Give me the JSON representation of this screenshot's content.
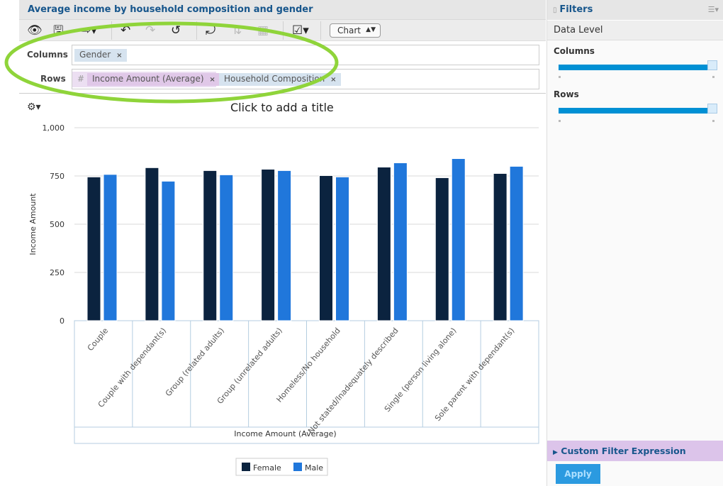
{
  "header": {
    "title": "Average income by household composition and gender"
  },
  "toolbar": {
    "chart_type": "Chart",
    "icons": [
      "eye-icon",
      "save-icon",
      "export-icon",
      "undo-icon",
      "redo-icon",
      "reset-icon",
      "swap-axis-icon",
      "sort-icon",
      "grid-icon",
      "options-icon"
    ]
  },
  "layout": {
    "columns_label": "Columns",
    "rows_label": "Rows",
    "columns": [
      {
        "label": "Gender",
        "remove": "×"
      }
    ],
    "rows_measure_prefix": "#",
    "rows": [
      {
        "label": "Income Amount (Average)",
        "remove": "×"
      },
      {
        "label": "Household Composition",
        "remove": "×"
      }
    ]
  },
  "chart_title_placeholder": "Click to add a title",
  "chart_data": {
    "type": "bar",
    "ylabel": "Income Amount",
    "xlabel": "Income Amount (Average)",
    "ylim": [
      0,
      1000
    ],
    "yticks": [
      "0",
      "250",
      "500",
      "750",
      "1,000"
    ],
    "grid": true,
    "legend": "bottom",
    "categories": [
      "Couple",
      "Couple with dependant(s)",
      "Group (related adults)",
      "Group (unrelated adults)",
      "Homeless/No household",
      "Not stated/Inadequately described",
      "Single (person living alone)",
      "Sole parent with dependant(s)"
    ],
    "series": [
      {
        "name": "Female",
        "color": "#0b233f",
        "values": [
          745,
          793,
          778,
          785,
          752,
          796,
          741,
          763
        ]
      },
      {
        "name": "Male",
        "color": "#2077db",
        "values": [
          758,
          723,
          756,
          778,
          745,
          818,
          840,
          800
        ]
      }
    ]
  },
  "filters": {
    "title": "Filters",
    "data_level": "Data Level",
    "columns_label": "Columns",
    "rows_label": "Rows",
    "columns_level": 1.0,
    "rows_level": 1.0,
    "custom_filter": "Custom Filter Expression",
    "apply": "Apply"
  },
  "colors": {
    "accent": "#17568c",
    "highlight": "#8fd43a",
    "apply": "#2b9ae0"
  }
}
